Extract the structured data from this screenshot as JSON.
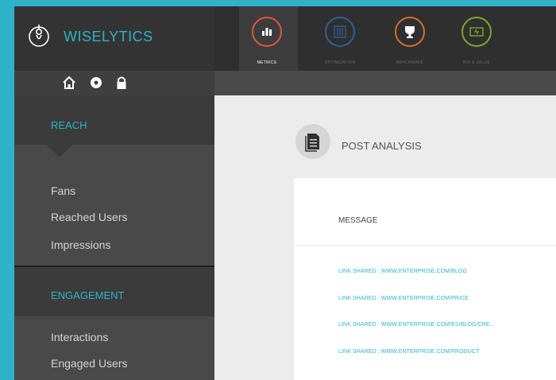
{
  "brand": {
    "name": "WISELYTICS"
  },
  "nav": {
    "tabs": [
      {
        "label": "METRICS",
        "icon": "bar-chart-icon",
        "color": "#e0524a",
        "active": true
      },
      {
        "label": "OPTIMIZATION",
        "icon": "sliders-icon",
        "color": "#2f5f9a",
        "active": false
      },
      {
        "label": "BENCHMARK",
        "icon": "trophy-icon",
        "color": "#d0702c",
        "active": false
      },
      {
        "label": "ROI & VALUE",
        "icon": "money-icon",
        "color": "#7aa82c",
        "active": false
      }
    ]
  },
  "subbar": {
    "icons": [
      "home-icon",
      "settings-icon",
      "lock-icon"
    ]
  },
  "sidebar": {
    "sections": [
      {
        "title": "REACH",
        "items": [
          "Fans",
          "Reached Users",
          "Impressions"
        ]
      },
      {
        "title": "ENGAGEMENT",
        "items": [
          "Interactions",
          "Engaged Users"
        ]
      }
    ]
  },
  "main": {
    "title": "POST ANALYSIS",
    "table": {
      "header": "MESSAGE",
      "rows": [
        "LINK SHARED : WWW.ENTERPRISE.COM/BLOG",
        "LINK SHARED : WWW.ENTERPRISE.COM/PRICE",
        "LINK SHARED : WWW.ENTERPRISE.COM/ES/BLOG/CRE...",
        "LINK SHARED : WWW.ENTERPRISE.COM/PRODUCT"
      ]
    }
  },
  "colors": {
    "accent": "#2eb3c9",
    "sidebar": "#494949",
    "topbar": "#2f2f2f"
  }
}
